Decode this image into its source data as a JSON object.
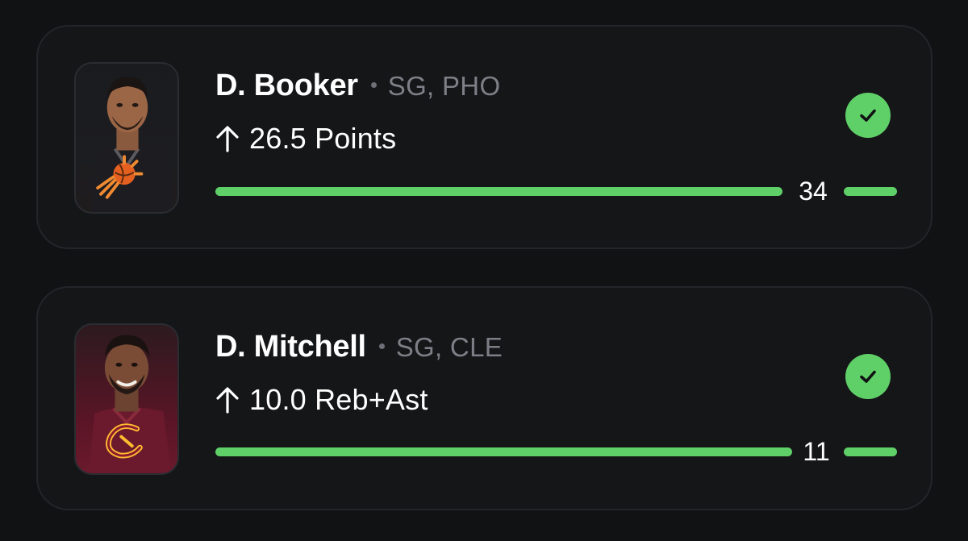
{
  "picks": [
    {
      "player": "D. Booker",
      "position_team": "SG, PHO",
      "prop": "26.5 Points",
      "direction": "up",
      "result": "34",
      "status": "hit",
      "team_logo": "suns-logo-icon"
    },
    {
      "player": "D. Mitchell",
      "position_team": "SG, CLE",
      "prop": "10.0 Reb+Ast",
      "direction": "up",
      "result": "11",
      "status": "hit",
      "team_logo": "cavaliers-logo-icon"
    }
  ],
  "colors": {
    "background": "#111214",
    "card": "#151618",
    "success": "#5fd068",
    "muted_text": "#7c7f86"
  }
}
